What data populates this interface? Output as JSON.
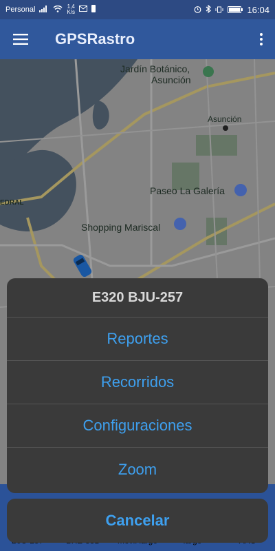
{
  "statusbar": {
    "carrier": "Personal",
    "speed_value": "1,4",
    "speed_unit": "K/s",
    "time": "16:04"
  },
  "appbar": {
    "title": "GPSRastro"
  },
  "map": {
    "labels": [
      {
        "text": "Jardín Botánico,"
      },
      {
        "text": "Asunción"
      },
      {
        "text": "Asunción"
      },
      {
        "text": "Paseo La Galería"
      },
      {
        "text": "Shopping Mariscal"
      },
      {
        "text": "EDRAL"
      }
    ]
  },
  "sheet": {
    "title": "E320 BJU-257",
    "items": [
      "Reportes",
      "Recorridos",
      "Configuraciones",
      "Zoom"
    ],
    "cancel": "Cancelar"
  },
  "vehicles": [
    "BJU-257",
    "BXE-381",
    "movil largo",
    "largo",
    "AAC"
  ],
  "colors": {
    "appbar": "#30589c",
    "statusbar": "#2d4a83",
    "sheet_bg": "#3a3a3a",
    "action_text": "#3ea0ef"
  }
}
